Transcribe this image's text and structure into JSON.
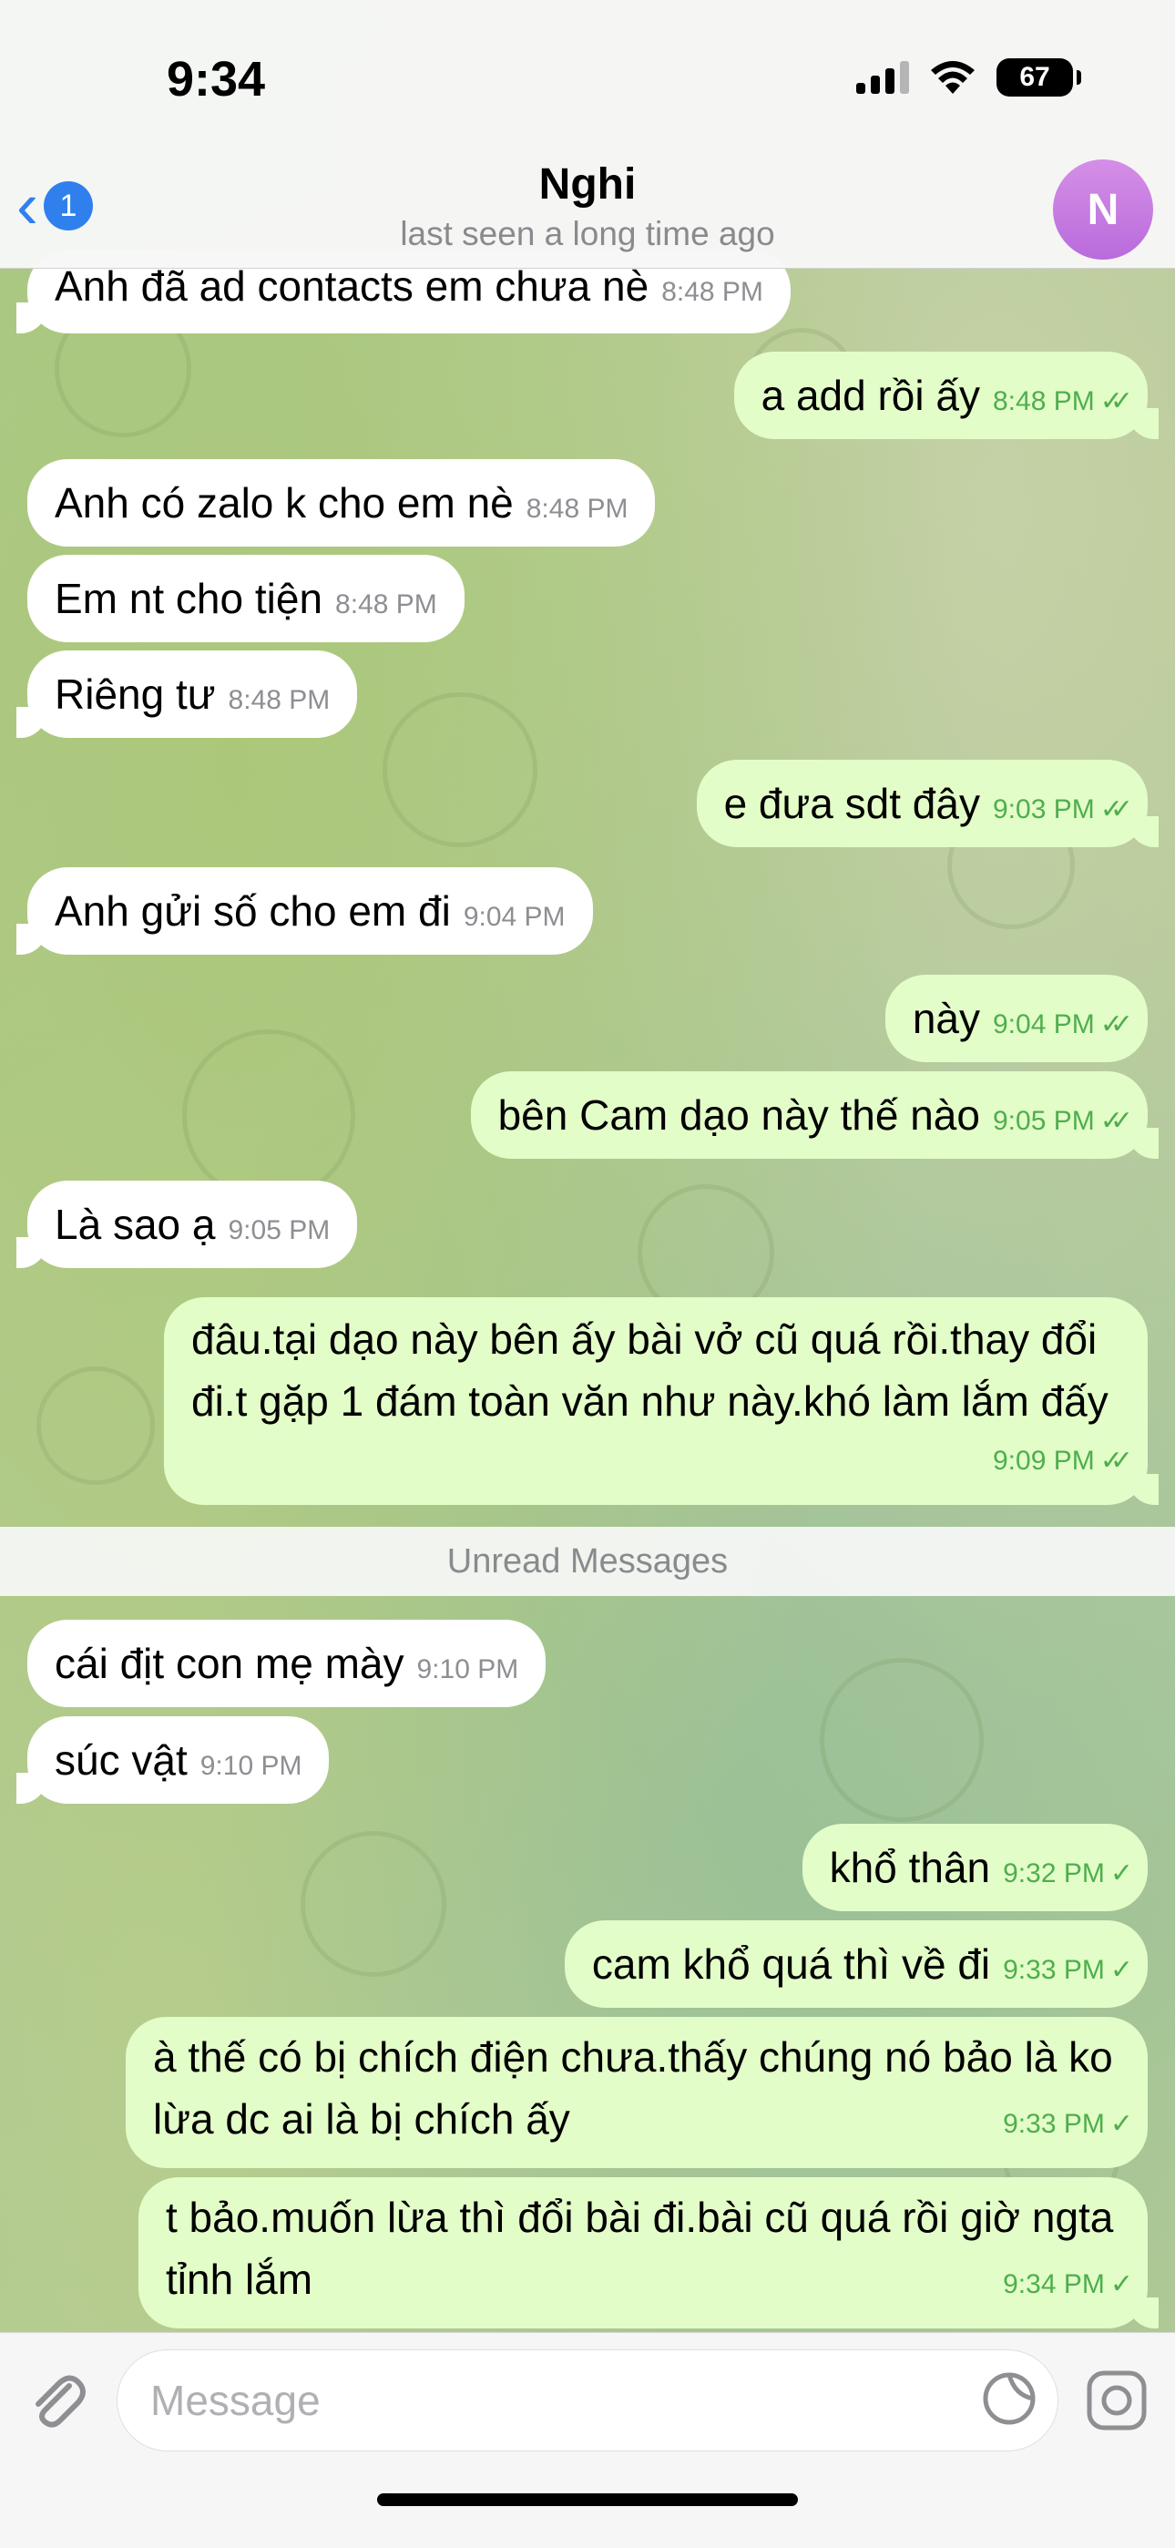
{
  "status_bar": {
    "time": "9:34",
    "battery": "67"
  },
  "header": {
    "back_count": "1",
    "contact_name": "Nghi",
    "contact_status": "last seen a long time ago",
    "avatar_initial": "N"
  },
  "messages": [
    {
      "dir": "in",
      "text": "Anh đã ad contacts em chưa nè",
      "time": "8:48 PM"
    },
    {
      "dir": "out",
      "text": "a add rồi ấy",
      "time": "8:48 PM",
      "status": "read"
    },
    {
      "dir": "in",
      "text": "Anh có zalo k cho em nè",
      "time": "8:48 PM"
    },
    {
      "dir": "in",
      "text": "Em nt cho tiện",
      "time": "8:48 PM"
    },
    {
      "dir": "in",
      "text": "Riêng tư",
      "time": "8:48 PM"
    },
    {
      "dir": "out",
      "text": "e đưa sdt đây",
      "time": "9:03 PM",
      "status": "read"
    },
    {
      "dir": "in",
      "text": "Anh gửi số cho em đi",
      "time": "9:04 PM"
    },
    {
      "dir": "out",
      "text": "này",
      "time": "9:04 PM",
      "status": "read"
    },
    {
      "dir": "out",
      "text": "bên Cam dạo này thế nào",
      "time": "9:05 PM",
      "status": "read"
    },
    {
      "dir": "in",
      "text": "Là sao ạ",
      "time": "9:05 PM"
    },
    {
      "dir": "out",
      "text": "đâu.tại dạo này bên ấy bài vở cũ quá rồi.thay đổi đi.t gặp 1 đám toàn văn như này.khó làm lắm đấy",
      "time": "9:09 PM",
      "status": "read"
    },
    {
      "dir": "in",
      "text": "cái địt con mẹ mày",
      "time": "9:10 PM"
    },
    {
      "dir": "in",
      "text": "súc vật",
      "time": "9:10 PM"
    },
    {
      "dir": "out",
      "text": "khổ thân",
      "time": "9:32 PM",
      "status": "sent"
    },
    {
      "dir": "out",
      "text": "cam khổ quá thì về đi",
      "time": "9:33 PM",
      "status": "sent"
    },
    {
      "dir": "out",
      "text": "à thế có bị chích điện chưa.thấy chúng nó bảo là ko lừa dc ai là bị chích ấy",
      "time": "9:33 PM",
      "status": "sent"
    },
    {
      "dir": "out",
      "text": "t bảo.muốn lừa thì đổi bài đi.bài cũ quá rồi giờ ngta tỉnh lắm",
      "time": "9:34 PM",
      "status": "sent"
    }
  ],
  "unread_divider": "Unread Messages",
  "input_bar": {
    "placeholder": "Message"
  },
  "icons": {
    "back": "chevron-left-icon",
    "attach": "paperclip-icon",
    "sticker": "sticker-icon",
    "camera": "instagram-camera-icon",
    "read_check": "double-check-icon",
    "sent_check": "single-check-icon"
  },
  "colors": {
    "accent": "#2f80ed",
    "outgoing_bubble": "#e3fdc8",
    "incoming_bubble": "#ffffff",
    "outgoing_meta": "#4fae4e",
    "avatar": "#c97de2"
  }
}
